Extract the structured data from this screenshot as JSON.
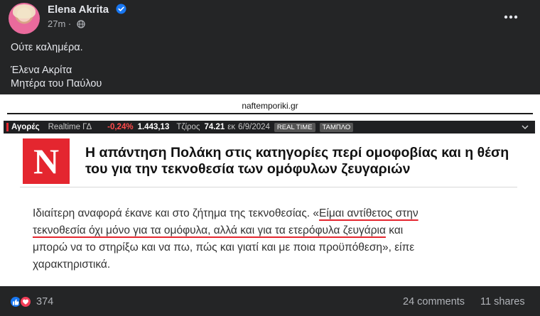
{
  "post": {
    "author": "Elena Akrita",
    "time": "27m",
    "text_lines": [
      "Ούτε καλημέρα.",
      "Έλενα Ακρίτα",
      "Μητέρα του Παύλου"
    ]
  },
  "shared": {
    "site": "naftemporiki.gr",
    "ticker": {
      "brand": "Αγορές",
      "realtime": "Realtime ΓΔ",
      "change": "-0,24%",
      "index": "1.443,13",
      "turnover_label": "Τζίρος",
      "turnover_value": "74.21",
      "turnover_unit": "εκ",
      "date": "6/9/2024",
      "pill1": "REAL TIME",
      "pill2": "ΤΑΜΠΛΟ"
    },
    "logo_letter": "N",
    "headline": "Η απάντηση Πολάκη στις κατηγορίες περί ομοφοβίας και η θέση του για την τεκνοθεσία των ομόφυλων ζευγαριών",
    "article": {
      "l1a": "Ιδιαίτερη αναφορά έκανε και στο ζήτημα της τεκνοθεσίας. «",
      "l1b": "Είμαι αντίθετος στην",
      "l2a": "τεκνοθεσία όχι μόνο για τα ομόφυλα, αλλά και για τα ετερόφυλα ζευγάρια",
      "l2b": " και",
      "l3": "μπορώ να το στηρίξω και να πω, πώς και γιατί και με ποια προϋπόθεση», είπε",
      "l4": "χαρακτηριστικά."
    }
  },
  "footer": {
    "reaction_count": "374",
    "comments": "24 comments",
    "shares": "11 shares"
  },
  "colors": {
    "background": "#242526",
    "accent_red": "#e4262f",
    "like_blue": "#1877f2",
    "love_red": "#f33e58",
    "verified_blue": "#1877f2"
  },
  "icons": [
    "verified-badge-icon",
    "globe-icon",
    "more-options-icon",
    "chevron-down-icon",
    "like-reaction-icon",
    "love-reaction-icon"
  ]
}
